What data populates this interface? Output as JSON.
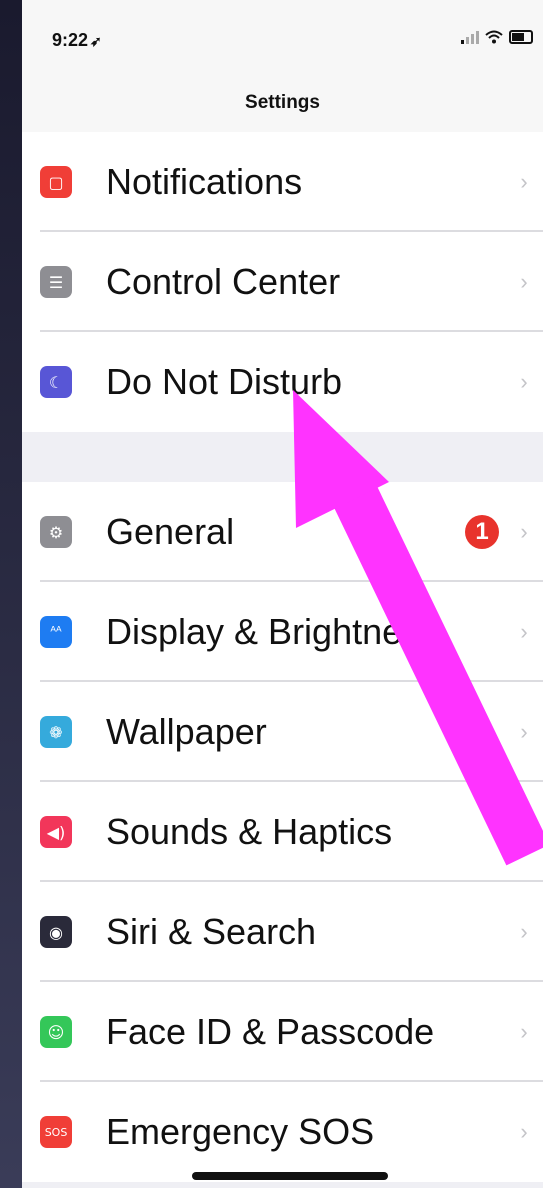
{
  "status": {
    "time": "9:22",
    "location_glyph": "➶"
  },
  "nav": {
    "title": "Settings"
  },
  "group1": [
    {
      "name": "row-notifications",
      "icon": "notifications-icon",
      "glyph": "▢",
      "color": "#f03e37",
      "label": "Notifications",
      "chevron": "›"
    },
    {
      "name": "row-control-center",
      "icon": "control-center-icon",
      "glyph": "☰",
      "color": "#8e8e93",
      "label": "Control Center",
      "chevron": "›"
    },
    {
      "name": "row-do-not-disturb",
      "icon": "moon-icon",
      "glyph": "☾",
      "color": "#5856d6",
      "label": "Do Not Disturb",
      "chevron": "›"
    }
  ],
  "group2": [
    {
      "name": "row-general",
      "icon": "gear-icon",
      "glyph": "⚙",
      "color": "#8e8e93",
      "label": "General",
      "badge": "1",
      "chevron": "›"
    },
    {
      "name": "row-display-brightness",
      "icon": "display-icon",
      "glyph": "ᴬᴬ",
      "color": "#1e7cf2",
      "label": "Display & Brightness",
      "chevron": "›"
    },
    {
      "name": "row-wallpaper",
      "icon": "wallpaper-icon",
      "glyph": "❁",
      "color": "#35aadc",
      "label": "Wallpaper",
      "chevron": "›"
    },
    {
      "name": "row-sounds-haptics",
      "icon": "speaker-icon",
      "glyph": "◀)",
      "color": "#f2365a",
      "label": "Sounds & Haptics",
      "chevron": "›"
    },
    {
      "name": "row-siri-search",
      "icon": "siri-icon",
      "glyph": "◉",
      "color": "#2a2a3a",
      "label": "Siri & Search",
      "chevron": "›"
    },
    {
      "name": "row-face-id",
      "icon": "face-id-icon",
      "glyph": "☺",
      "color": "#34c759",
      "label": "Face ID & Passcode",
      "chevron": "›"
    },
    {
      "name": "row-emergency-sos",
      "icon": "sos-icon",
      "glyph": "SOS",
      "color": "#f03e37",
      "label": "Emergency SOS",
      "chevron": "›"
    }
  ],
  "annotation": {
    "arrow_color": "#ff33ff"
  }
}
